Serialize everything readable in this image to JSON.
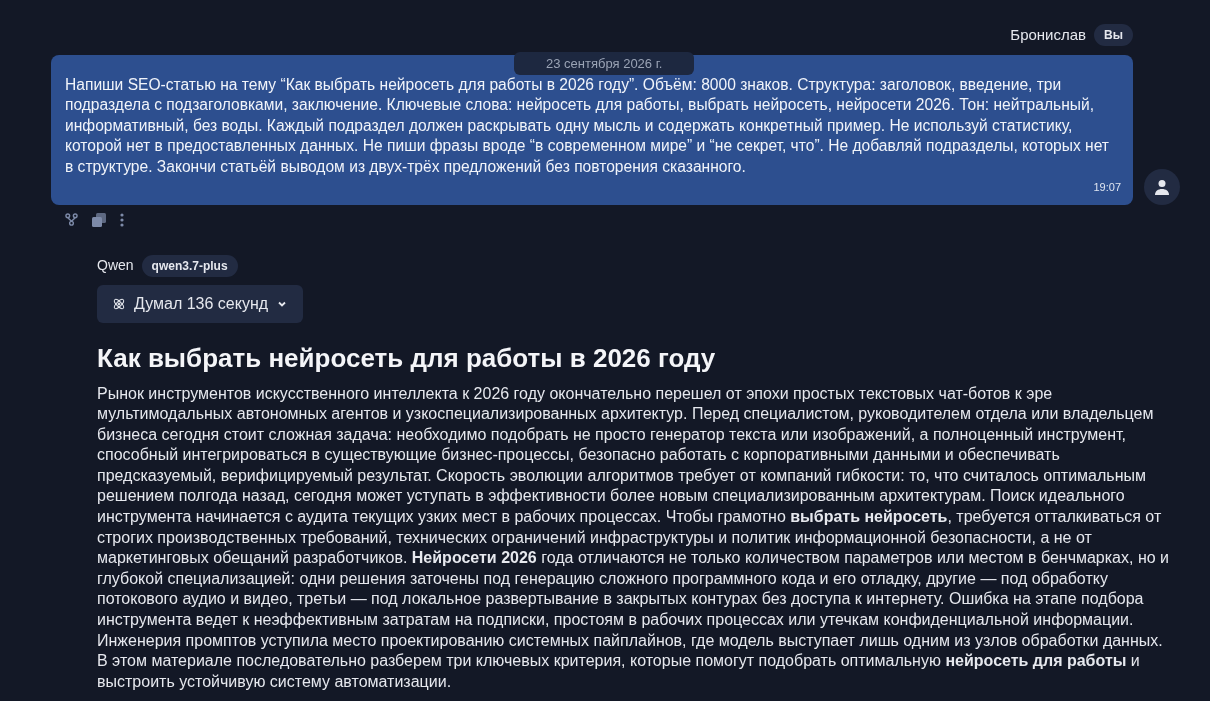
{
  "user_message": {
    "author": "Бронислав",
    "badge": "Вы",
    "text": "Напиши SEO-статью на тему “Как выбрать нейросеть для работы в 2026 году”. Объём: 8000 знаков. Структура: заголовок, введение, три подраздела с подзаголовками, заключение. Ключевые слова: нейросеть для работы, выбрать нейросеть, нейросети 2026. Тон: нейтральный, информативный, без воды. Каждый подраздел должен раскрывать одну мысль и содержать конкретный пример. Не используй статистику, которой нет в предоставленных данных. Не пиши фразы вроде “в современном мире” и “не секрет, что”. Не добавляй подразделы, которых нет в структуре. Закончи статьёй выводом из двух-трёх предложений без повторения сказанного.",
    "time": "19:07",
    "date": "23 сентября 2026 г."
  },
  "assistant_message": {
    "author": "Qwen",
    "model": "qwen3.7-plus",
    "thinking": {
      "label": "Думал 136 секунд",
      "expanded": false
    },
    "heading": "Как выбрать нейросеть для работы в 2026 году",
    "paragraph": "Рынок инструментов искусственного интеллекта к 2026 году окончательно перешел от эпохи простых текстовых чат-ботов к эре мультимодальных автономных агентов и узкоспециализированных архитектур. Перед специалистом, руководителем отдела или владельцем бизнеса сегодня стоит сложная задача: необходимо подобрать не просто генератор текста или изображений, а полноценный инструмент, способный интегрироваться в существующие бизнес-процессы, безопасно работать с корпоративными данными и обеспечивать предсказуемый, верифицируемый результат. Скорость эволюции алгоритмов требует от компаний гибкости: то, что считалось оптимальным решением полгода назад, сегодня может уступать в эффективности более новым специализированным архитектурам. Поиск идеального инструмента начинается с аудита текущих узких мест в рабочих процессах. Чтобы грамотно **выбрать нейросеть**, требуется отталкиваться от строгих производственных требований, технических ограничений инфраструктуры и политик информационной безопасности, а не от маркетинговых обещаний разработчиков. **Нейросети 2026** года отличаются не только количеством параметров или местом в бенчмарках, но и глубокой специализацией: одни решения заточены под генерацию сложного программного кода и его отладку, другие — под обработку потокового аудио и видео, третьи — под локальное развертывание в закрытых контурах без доступа к интернету. Ошибка на этапе подбора инструмента ведет к неэффективным затратам на подписки, простоям в рабочих процессах или утечкам конфиденциальной информации. Инженерия промптов уступила место проектированию системных пайплайнов, где модель выступает лишь одним из узлов обработки данных. В этом материале последовательно разберем три ключевых критерия, которые помогут подобрать оптимальную **нейросеть для работы** и выстроить устойчивую систему автоматизации."
  }
}
